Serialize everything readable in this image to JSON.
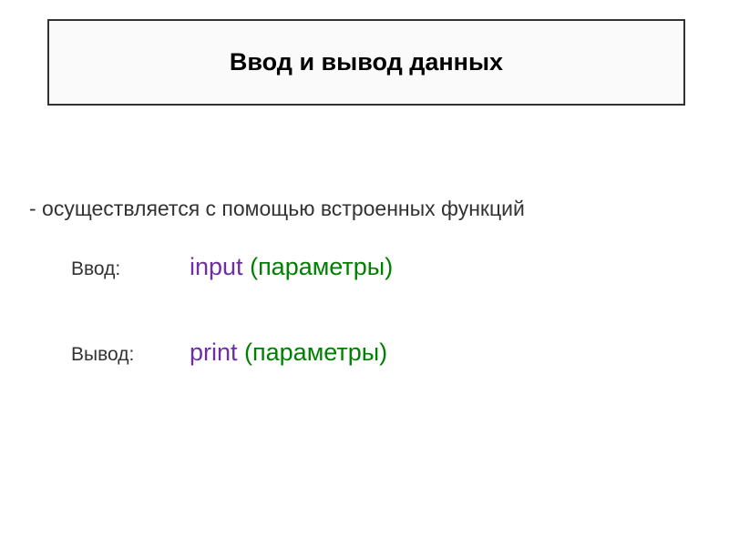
{
  "title": "Ввод и вывод данных",
  "description": "- осуществляется с помощью встроенных функций",
  "input": {
    "label": "Ввод:",
    "func": "input ",
    "openParen": "(",
    "param": "параметры",
    "closeParen": ")"
  },
  "output": {
    "label": "Вывод:",
    "func": "print ",
    "openParen": "(",
    "param": "параметры",
    "closeParen": ")"
  }
}
